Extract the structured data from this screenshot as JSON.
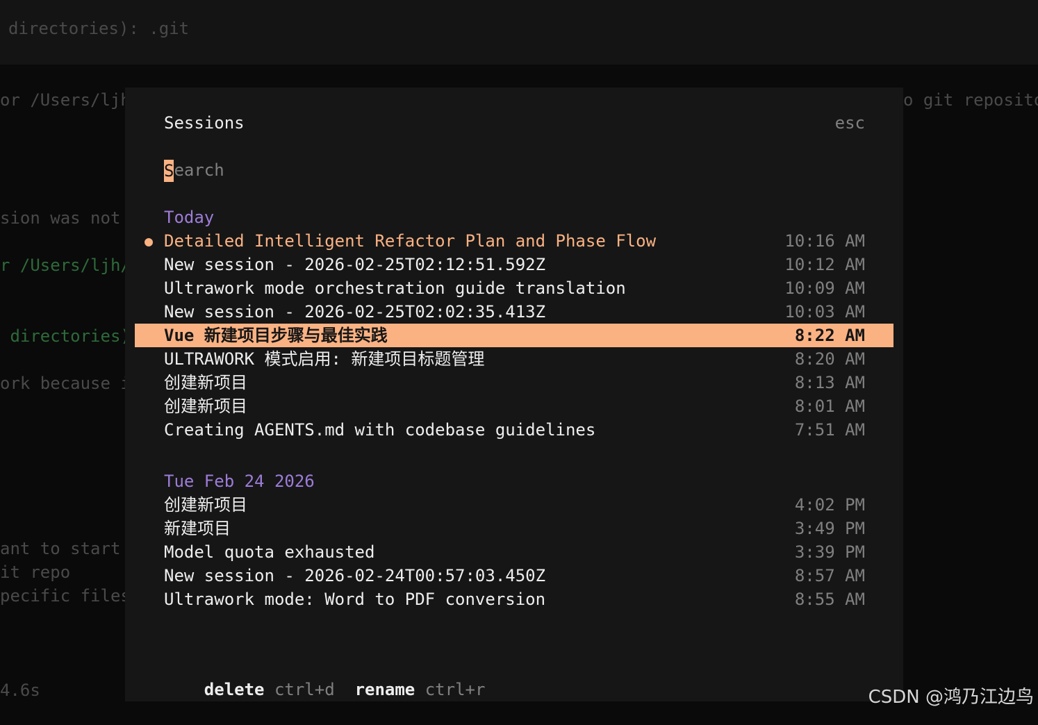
{
  "background": {
    "top_line": "directories): .git",
    "left_lines": [
      {
        "text": "or /Users/ljh",
        "green": false
      },
      {
        "text": "sion was not",
        "green": false
      },
      {
        "text": "r /Users/ljh/",
        "green": true
      },
      {
        "text": " directories)",
        "green": true
      },
      {
        "text": "ork because i",
        "green": false
      },
      {
        "text": "ant to start",
        "green": false
      },
      {
        "text": "it repo",
        "green": false
      },
      {
        "text": "pecific files",
        "green": false
      },
      {
        "text": "4.6s",
        "green": false
      }
    ],
    "right_line": "o git reposito"
  },
  "dialog": {
    "title": "Sessions",
    "close_hint": "esc",
    "search_placeholder": "Search",
    "cursor_char": "S",
    "groups": [
      {
        "label": "Today",
        "sessions": [
          {
            "title": "Detailed Intelligent Refactor Plan and Phase Flow",
            "time": "10:16 AM",
            "current": true
          },
          {
            "title": "New session - 2026-02-25T02:12:51.592Z",
            "time": "10:12 AM"
          },
          {
            "title": "Ultrawork mode orchestration guide translation",
            "time": "10:09 AM"
          },
          {
            "title": "New session - 2026-02-25T02:02:35.413Z",
            "time": "10:03 AM"
          },
          {
            "title": "Vue 新建项目步骤与最佳实践",
            "time": "8:22 AM",
            "selected": true
          },
          {
            "title": "ULTRAWORK 模式启用: 新建项目标题管理",
            "time": "8:20 AM"
          },
          {
            "title": "创建新项目",
            "time": "8:13 AM"
          },
          {
            "title": "创建新项目",
            "time": "8:01 AM"
          },
          {
            "title": "Creating AGENTS.md with codebase guidelines",
            "time": "7:51 AM"
          }
        ]
      },
      {
        "label": "Tue Feb 24 2026",
        "sessions": [
          {
            "title": "创建新项目",
            "time": "4:02 PM"
          },
          {
            "title": "新建项目",
            "time": "3:49 PM"
          },
          {
            "title": "Model quota exhausted",
            "time": "3:39 PM"
          },
          {
            "title": "New session - 2026-02-24T00:57:03.450Z",
            "time": "8:57 AM"
          },
          {
            "title": "Ultrawork mode: Word to PDF conversion",
            "time": "8:55 AM"
          }
        ]
      }
    ],
    "footer": [
      {
        "label": "delete",
        "shortcut": "ctrl+d"
      },
      {
        "label": "rename",
        "shortcut": "ctrl+r"
      }
    ]
  },
  "watermark": "CSDN @鸿乃江边鸟",
  "colors": {
    "accent": "#fab283",
    "group": "#9d7cd8",
    "muted": "#808080",
    "panel": "#161616"
  }
}
